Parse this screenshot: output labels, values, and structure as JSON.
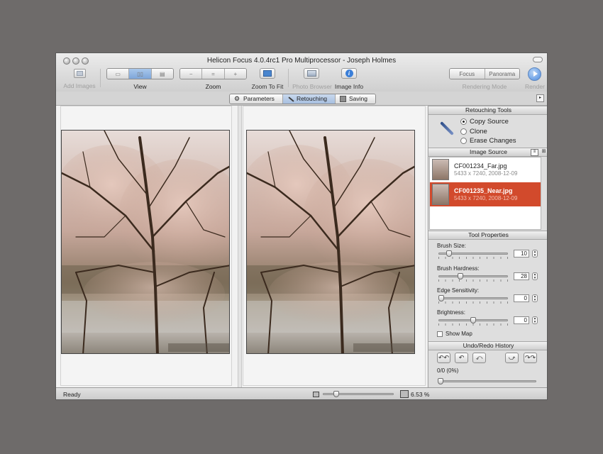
{
  "window": {
    "title": "Helicon Focus 4.0.4rc1 Pro Multiprocessor - Joseph Holmes"
  },
  "toolbar": {
    "add_images": "Add Images",
    "view": "View",
    "zoom": "Zoom",
    "zoom_to_fit": "Zoom To Fit",
    "photo_browser": "Photo Browser",
    "image_info": "Image Info",
    "rendering_mode_label": "Rendering Mode",
    "render": "Render",
    "modes": [
      "Focus",
      "Panorama"
    ]
  },
  "tabs": [
    {
      "label": "Parameters",
      "icon": "gear-icon"
    },
    {
      "label": "Retouching",
      "icon": "brush-icon",
      "selected": true
    },
    {
      "label": "Saving",
      "icon": "save-icon"
    }
  ],
  "retouching_tools": {
    "header": "Retouching Tools",
    "options": [
      "Copy Source",
      "Clone",
      "Erase Changes"
    ],
    "selected": "Copy Source",
    "icon": "brush-icon"
  },
  "image_source": {
    "header": "Image Source",
    "items": [
      {
        "name": "CF001234_Far.jpg",
        "meta": "5433 x 7240, 2008-12-09"
      },
      {
        "name": "CF001235_Near.jpg",
        "meta": "5433 x 7240, 2008-12-09",
        "selected": true
      }
    ]
  },
  "tool_properties": {
    "header": "Tool Properties",
    "brush_size": {
      "label": "Brush Size:",
      "value": "10",
      "fraction": 0.12
    },
    "brush_hardness": {
      "label": "Brush Hardness:",
      "value": "28",
      "fraction": 0.3
    },
    "edge_sensitivity": {
      "label": "Edge Sensitivity:",
      "value": "0",
      "fraction": 0.0
    },
    "brightness": {
      "label": "Brightness:",
      "value": "0",
      "fraction": 0.5
    },
    "show_map": "Show Map"
  },
  "history": {
    "header": "Undo/Redo History",
    "status": "0/0 (0%)"
  },
  "status": {
    "text": "Ready",
    "zoom": "6.53 %"
  },
  "colors": {
    "selection": "#d24a2c",
    "accent_blue": "#3b7fd8"
  }
}
